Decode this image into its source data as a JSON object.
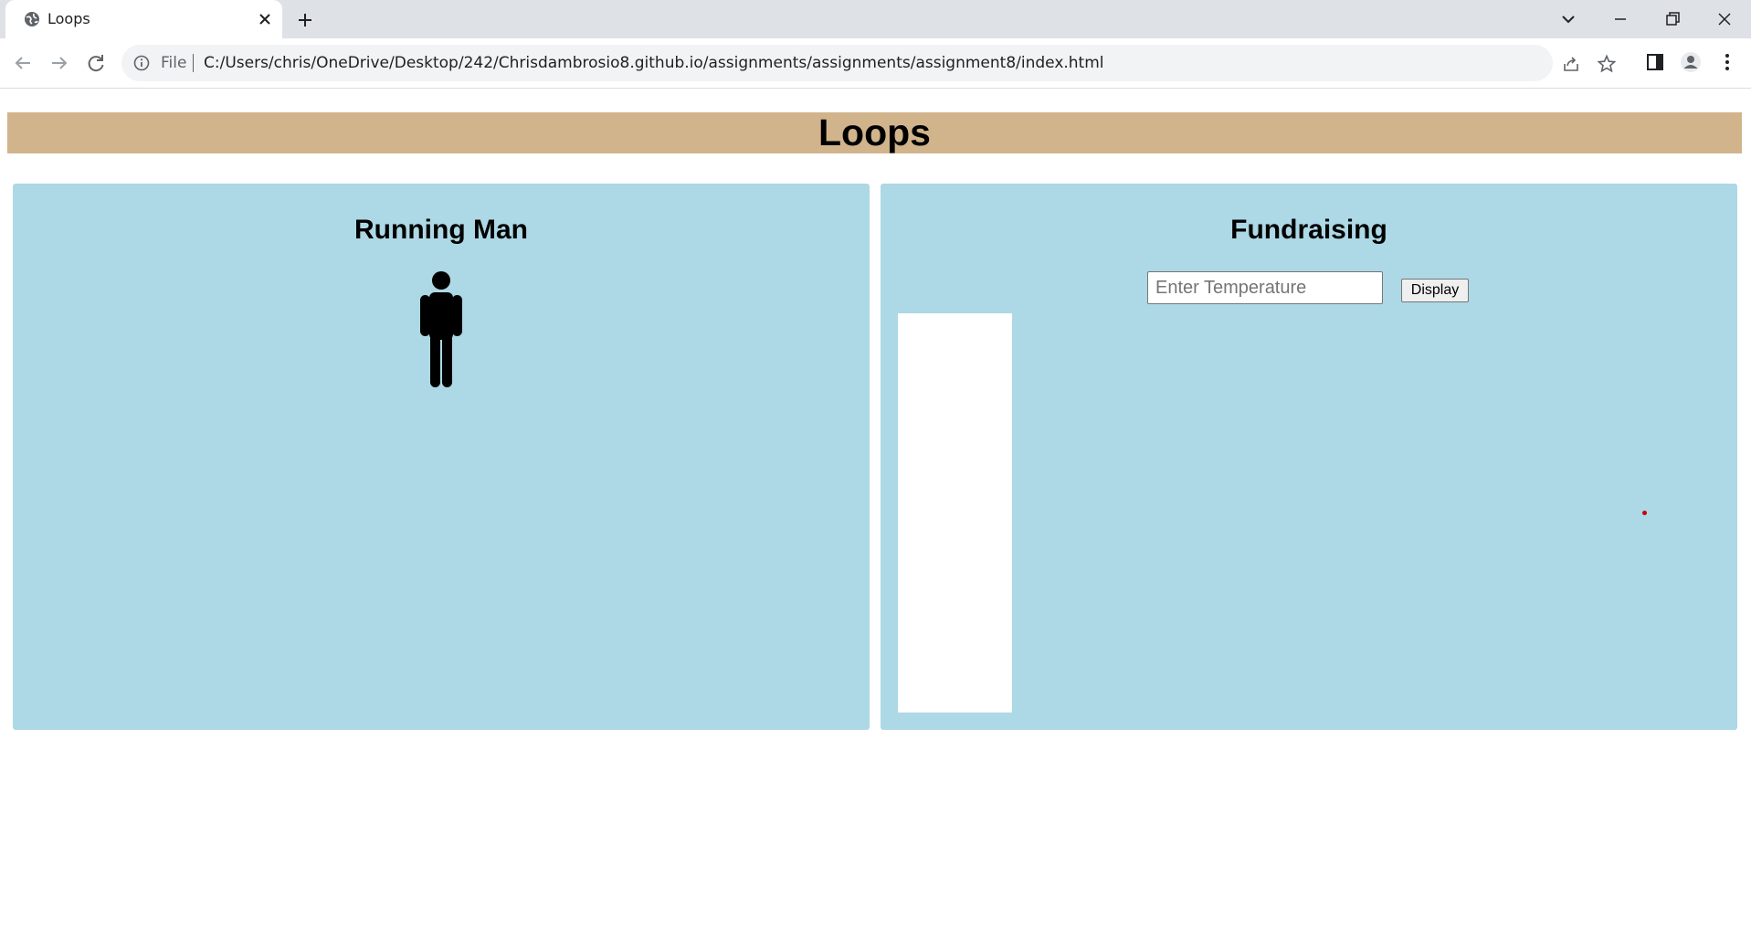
{
  "browser": {
    "tab_title": "Loops",
    "file_label": "File",
    "url": "C:/Users/chris/OneDrive/Desktop/242/Chrisdambrosio8.github.io/assignments/assignments/assignment8/index.html"
  },
  "page": {
    "title": "Loops",
    "running_man": {
      "heading": "Running Man"
    },
    "fundraising": {
      "heading": "Fundraising",
      "input_placeholder": "Enter Temperature",
      "input_value": "",
      "button_label": "Display"
    }
  },
  "colors": {
    "header_bg": "#d2b48c",
    "panel_bg": "#add8e6",
    "thermometer_bg": "#ffffff",
    "dot": "#cc0000"
  }
}
